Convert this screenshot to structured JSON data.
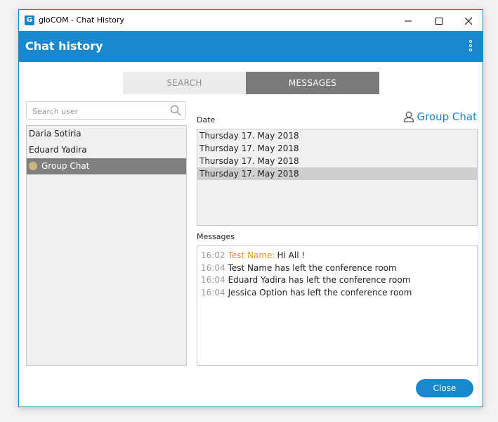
{
  "window": {
    "title": "gloCOM - Chat History",
    "app_icon": "G"
  },
  "header": {
    "title": "Chat history"
  },
  "tabs": [
    {
      "label": "SEARCH"
    },
    {
      "label": "MESSAGES"
    }
  ],
  "search": {
    "placeholder": "Search user",
    "value": ""
  },
  "users": [
    {
      "name": "Daria Sotiria"
    },
    {
      "name": "Eduard Yadira"
    },
    {
      "name": "Group Chat"
    }
  ],
  "date_section": {
    "label": "Date",
    "group_chat_label": "Group Chat"
  },
  "dates": [
    {
      "label": "Thursday 17. May 2018"
    },
    {
      "label": "Thursday 17. May 2018"
    },
    {
      "label": "Thursday 17. May 2018"
    },
    {
      "label": "Thursday 17. May 2018"
    }
  ],
  "messages_section": {
    "label": "Messages"
  },
  "messages": [
    {
      "time": "16:02",
      "sender": "Test Name:",
      "text": "Hi All !"
    },
    {
      "time": "16:04",
      "text": "Test Name has left the conference room"
    },
    {
      "time": "16:04",
      "text": "Eduard Yadira has left the conference room"
    },
    {
      "time": "16:04",
      "text": "Jessica Option has left the conference room"
    }
  ],
  "footer": {
    "close_label": "Close"
  },
  "colors": {
    "accent": "#1a88cc",
    "sender": "#f0962b",
    "selected_row": "#808080"
  }
}
